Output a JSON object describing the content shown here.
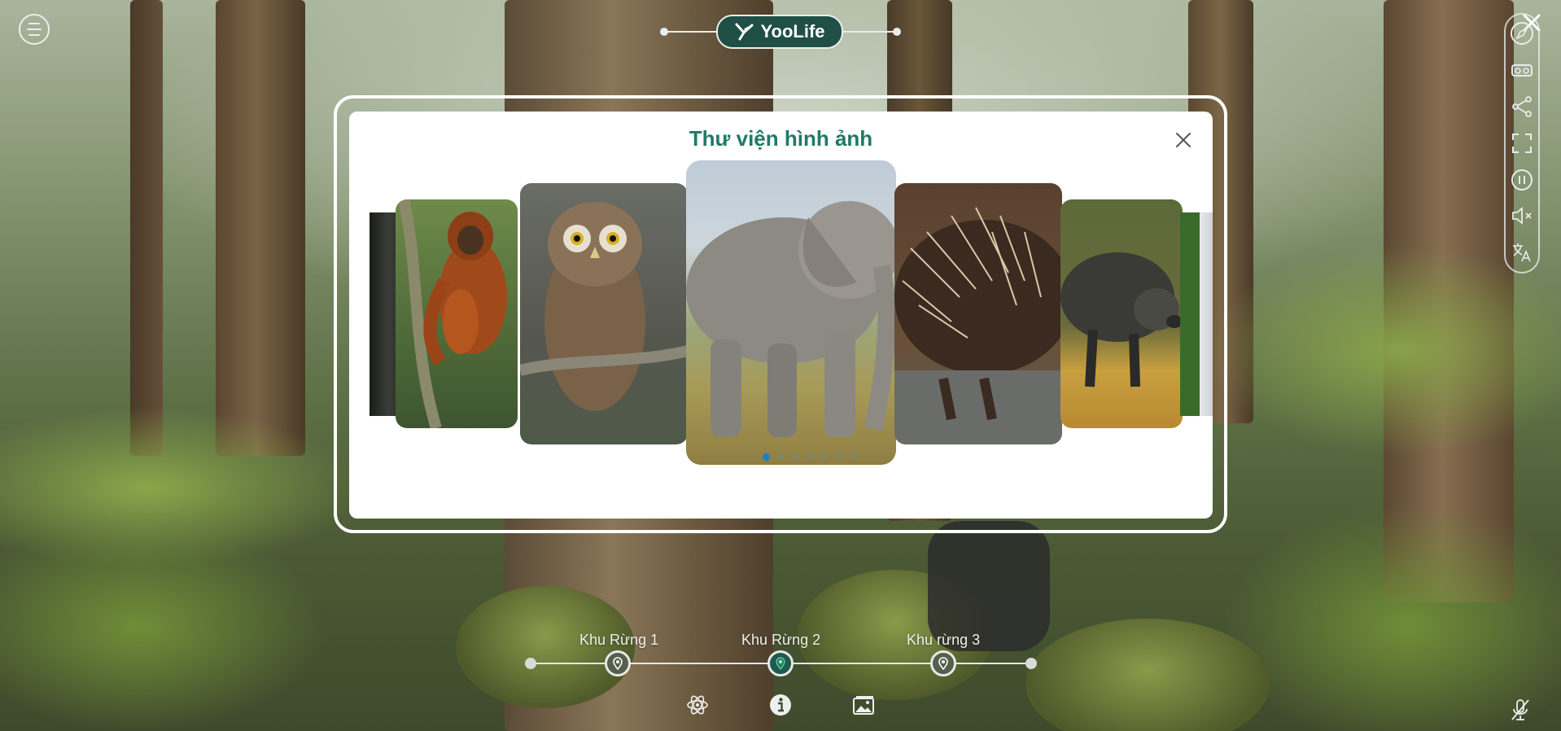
{
  "header": {
    "logo_text": "YooLife"
  },
  "modal": {
    "title": "Thư viện hình ảnh",
    "gallery": [
      {
        "subject": "gorilla"
      },
      {
        "subject": "orangutan"
      },
      {
        "subject": "owl"
      },
      {
        "subject": "elephant"
      },
      {
        "subject": "porcupine"
      },
      {
        "subject": "wild boar"
      },
      {
        "subject": "animal"
      }
    ],
    "active_index": 0,
    "slide_count": 7
  },
  "timeline": {
    "items": [
      {
        "label": "Khu Rừng 1",
        "active": false
      },
      {
        "label": "Khu Rừng 2",
        "active": true
      },
      {
        "label": "Khu rừng 3",
        "active": false
      }
    ]
  },
  "toolbar": {
    "icons": [
      "compass-icon",
      "vr-headset-icon",
      "share-icon",
      "fullscreen-icon",
      "pause-icon",
      "mute-icon",
      "translate-icon"
    ]
  },
  "colors": {
    "brand": "#1f4f46",
    "title": "#1f7a68",
    "active_dot": "#1a7fd0"
  }
}
